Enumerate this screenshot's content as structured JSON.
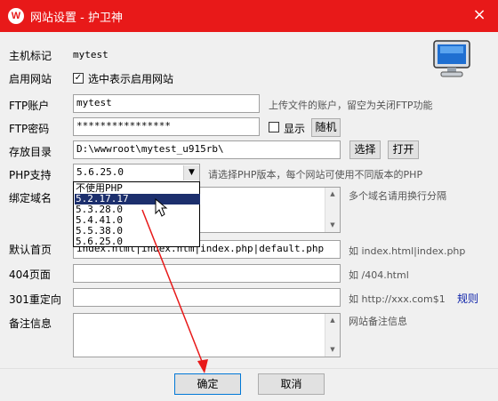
{
  "window": {
    "title": "网站设置 - 护卫神",
    "logo": "W",
    "close": "×"
  },
  "form": {
    "host_label": "主机标记",
    "host_value": "mytest",
    "enable_label": "启用网站",
    "enable_check": "选中表示启用网站",
    "ftp_user_label": "FTP账户",
    "ftp_user_value": "mytest",
    "ftp_user_hint": "上传文件的账户，留空为关闭FTP功能",
    "ftp_pass_label": "FTP密码",
    "ftp_pass_value": "****************",
    "show_label": "显示",
    "random_btn": "随机",
    "dir_label": "存放目录",
    "dir_value": "D:\\wwwroot\\mytest_u915rb\\",
    "select_btn": "选择",
    "open_btn": "打开",
    "php_label": "PHP支持",
    "php_value": "5.6.25.0",
    "php_hint": "请选择PHP版本，每个网站可使用不同版本的PHP",
    "php_options": [
      "不使用PHP",
      "5.2.17.17",
      "5.3.28.0",
      "5.4.41.0",
      "5.5.38.0",
      "5.6.25.0"
    ],
    "domain_label": "绑定域名",
    "domain_hint": "多个域名请用换行分隔",
    "index_label": "默认首页",
    "index_value": "index.html|index.htm|index.php|default.php",
    "index_hint": "如 index.html|index.php",
    "p404_label": "404页面",
    "p404_hint": "如 /404.html",
    "r301_label": "301重定向",
    "r301_hint": "如 http://xxx.com$1",
    "r301_link": "规则",
    "note_label": "备注信息",
    "note_hint": "网站备注信息"
  },
  "buttons": {
    "ok": "确定",
    "cancel": "取消"
  }
}
